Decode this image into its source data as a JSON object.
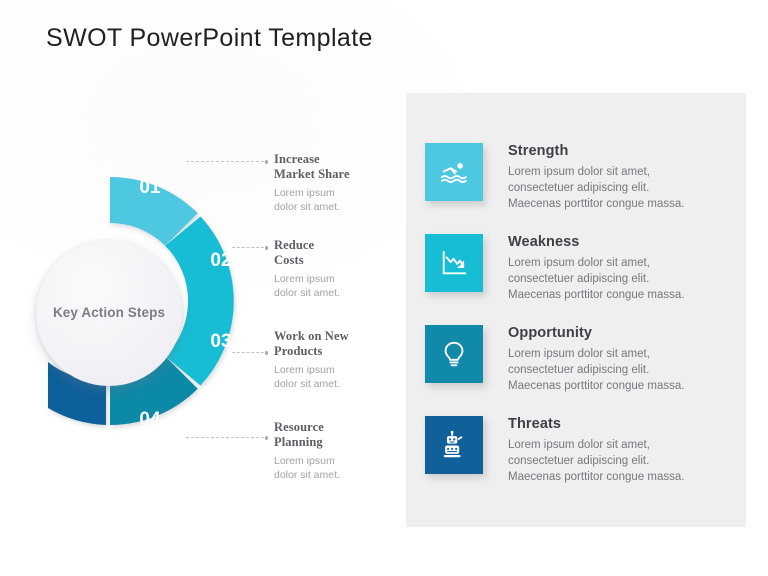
{
  "slide": {
    "title": "SWOT PowerPoint Template",
    "background_color": "#ffffff",
    "panel_color": "#efefef"
  },
  "wheel": {
    "hub_label": "Key Action\nSteps",
    "hub_color": "#f1f1f5",
    "segments": [
      {
        "number": "01",
        "color": "#4dc8e0"
      },
      {
        "number": "02",
        "color": "#17bdd5"
      },
      {
        "number": "03",
        "color": "#1189a8"
      },
      {
        "number": "04",
        "color": "#10609a"
      }
    ]
  },
  "steps": [
    {
      "number": "01",
      "title": "Increase\nMarket Share",
      "description": "Lorem ipsum\ndolor sit amet."
    },
    {
      "number": "02",
      "title": "Reduce\nCosts",
      "description": "Lorem ipsum\ndolor sit amet."
    },
    {
      "number": "03",
      "title": "Work on New\nProducts",
      "description": "Lorem ipsum\ndolor sit amet."
    },
    {
      "number": "04",
      "title": "Resource\nPlanning",
      "description": "Lorem ipsum\ndolor sit amet."
    }
  ],
  "swot": [
    {
      "heading": "Strength",
      "body": "Lorem ipsum dolor sit amet,\nconsectetuer adipiscing elit.\nMaecenas porttitor congue massa.",
      "icon": "swimmer-icon",
      "tile_color": "#4dc8e0"
    },
    {
      "heading": "Weakness",
      "body": "Lorem ipsum dolor sit amet,\nconsectetuer adipiscing elit.\nMaecenas porttitor congue massa.",
      "icon": "declining-chart-icon",
      "tile_color": "#17bdd5"
    },
    {
      "heading": "Opportunity",
      "body": "Lorem ipsum dolor sit amet,\nconsectetuer adipiscing elit.\nMaecenas porttitor congue massa.",
      "icon": "lightbulb-icon",
      "tile_color": "#1189a8"
    },
    {
      "heading": "Threats",
      "body": "Lorem ipsum dolor sit amet,\nconsectetuer adipiscing elit.\nMaecenas porttitor congue massa.",
      "icon": "robot-icon",
      "tile_color": "#10609a"
    }
  ]
}
